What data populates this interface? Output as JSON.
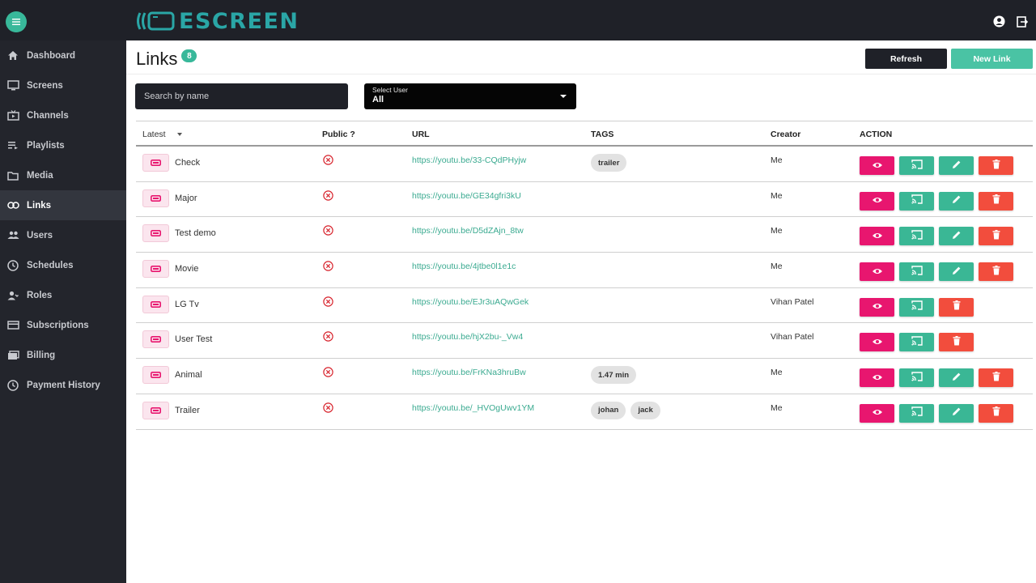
{
  "app": {
    "logo_text": "ESCREEN"
  },
  "sidebar": {
    "items": [
      {
        "label": "Dashboard",
        "icon": "home-icon"
      },
      {
        "label": "Screens",
        "icon": "monitor-icon"
      },
      {
        "label": "Channels",
        "icon": "channel-icon"
      },
      {
        "label": "Playlists",
        "icon": "playlist-icon"
      },
      {
        "label": "Media",
        "icon": "folder-icon"
      },
      {
        "label": "Links",
        "icon": "link-icon",
        "active": true
      },
      {
        "label": "Users",
        "icon": "users-icon"
      },
      {
        "label": "Schedules",
        "icon": "clock-icon"
      },
      {
        "label": "Roles",
        "icon": "role-icon"
      },
      {
        "label": "Subscriptions",
        "icon": "card-icon"
      },
      {
        "label": "Billing",
        "icon": "billing-icon"
      },
      {
        "label": "Payment History",
        "icon": "history-icon"
      }
    ]
  },
  "header": {
    "title": "Links",
    "count": "8",
    "refresh_label": "Refresh",
    "new_label": "New Link"
  },
  "filters": {
    "search_placeholder": "Search by name",
    "select_label": "Select User",
    "select_value": "All"
  },
  "table": {
    "columns": {
      "sort": "Latest",
      "public": "Public ?",
      "url": "URL",
      "tags": "TAGS",
      "creator": "Creator",
      "action": "ACTION"
    },
    "rows": [
      {
        "name": "Check",
        "url": "https://youtu.be/33-CQdPHyjw",
        "tags": [
          "trailer"
        ],
        "creator": "Me",
        "editable": true
      },
      {
        "name": "Major",
        "url": "https://youtu.be/GE34gfri3kU",
        "tags": [],
        "creator": "Me",
        "editable": true
      },
      {
        "name": "Test demo",
        "url": "https://youtu.be/D5dZAjn_8tw",
        "tags": [],
        "creator": "Me",
        "editable": true
      },
      {
        "name": "Movie",
        "url": "https://youtu.be/4jtbe0l1e1c",
        "tags": [],
        "creator": "Me",
        "editable": true
      },
      {
        "name": "LG Tv",
        "url": "https://youtu.be/EJr3uAQwGek",
        "tags": [],
        "creator": "Vihan Patel",
        "editable": false
      },
      {
        "name": "User Test",
        "url": "https://youtu.be/hjX2bu-_Vw4",
        "tags": [],
        "creator": "Vihan Patel",
        "editable": false
      },
      {
        "name": "Animal",
        "url": "https://youtu.be/FrKNa3hruBw",
        "tags": [
          "1.47 min"
        ],
        "creator": "Me",
        "editable": true
      },
      {
        "name": "Trailer",
        "url": "https://youtu.be/_HVOgUwv1YM",
        "tags": [
          "johan",
          "jack"
        ],
        "creator": "Me",
        "editable": true
      }
    ]
  },
  "colors": {
    "accent": "#38b89a",
    "pink": "#e8166f",
    "red": "#f24d3d",
    "dark": "#1f2128"
  }
}
